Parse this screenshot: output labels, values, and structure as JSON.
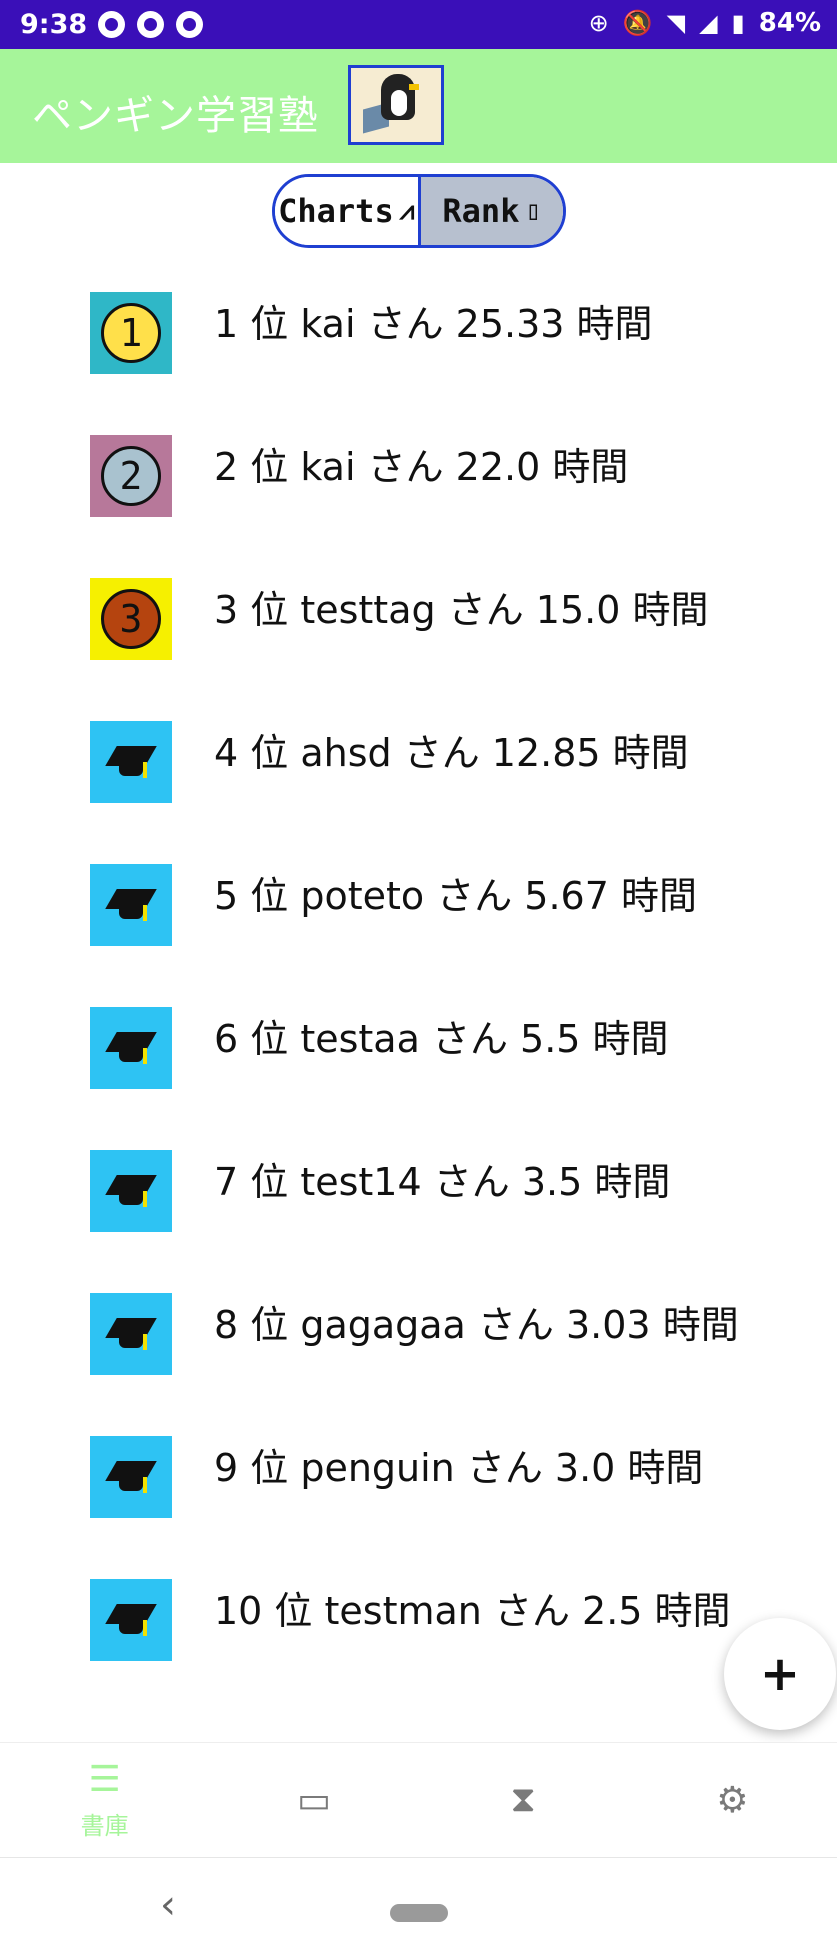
{
  "status_bar": {
    "time": "9:38",
    "battery": "84%"
  },
  "app_bar": {
    "title": "ペンギン学習塾"
  },
  "toggle": {
    "charts_label": "Charts",
    "rank_label": "Rank",
    "selected": "Rank"
  },
  "ranking": [
    {
      "rank": "1",
      "text": "1 位  kai さん  25.33 時間"
    },
    {
      "rank": "2",
      "text": "2 位  kai さん  22.0 時間"
    },
    {
      "rank": "3",
      "text": "3 位  testtag さん  15.0 時間"
    },
    {
      "rank": "4",
      "text": "4 位  ahsd さん  12.85 時間"
    },
    {
      "rank": "5",
      "text": "5 位  poteto さん  5.67 時間"
    },
    {
      "rank": "6",
      "text": "6 位  testaa さん  5.5 時間"
    },
    {
      "rank": "7",
      "text": "7 位  test14 さん  3.5 時間"
    },
    {
      "rank": "8",
      "text": "8 位  gagagaa さん  3.03 時間"
    },
    {
      "rank": "9",
      "text": "9 位  penguin さん  3.0 時間"
    },
    {
      "rank": "10",
      "text": "10 位  testman さん  2.5 時間"
    }
  ],
  "fab": {
    "label": "+"
  },
  "bottom_nav": {
    "items": [
      {
        "label": "書庫",
        "icon": "list-icon",
        "active": true
      },
      {
        "label": "",
        "icon": "film-icon",
        "active": false
      },
      {
        "label": "",
        "icon": "hourglass-icon",
        "active": false
      },
      {
        "label": "",
        "icon": "gear-icon",
        "active": false
      }
    ]
  },
  "colors": {
    "status_bar": "#3a0fb8",
    "app_bar": "#a6f59a",
    "accent_blue": "#1f3fd1",
    "badge_cap_bg": "#2ec3f3"
  }
}
